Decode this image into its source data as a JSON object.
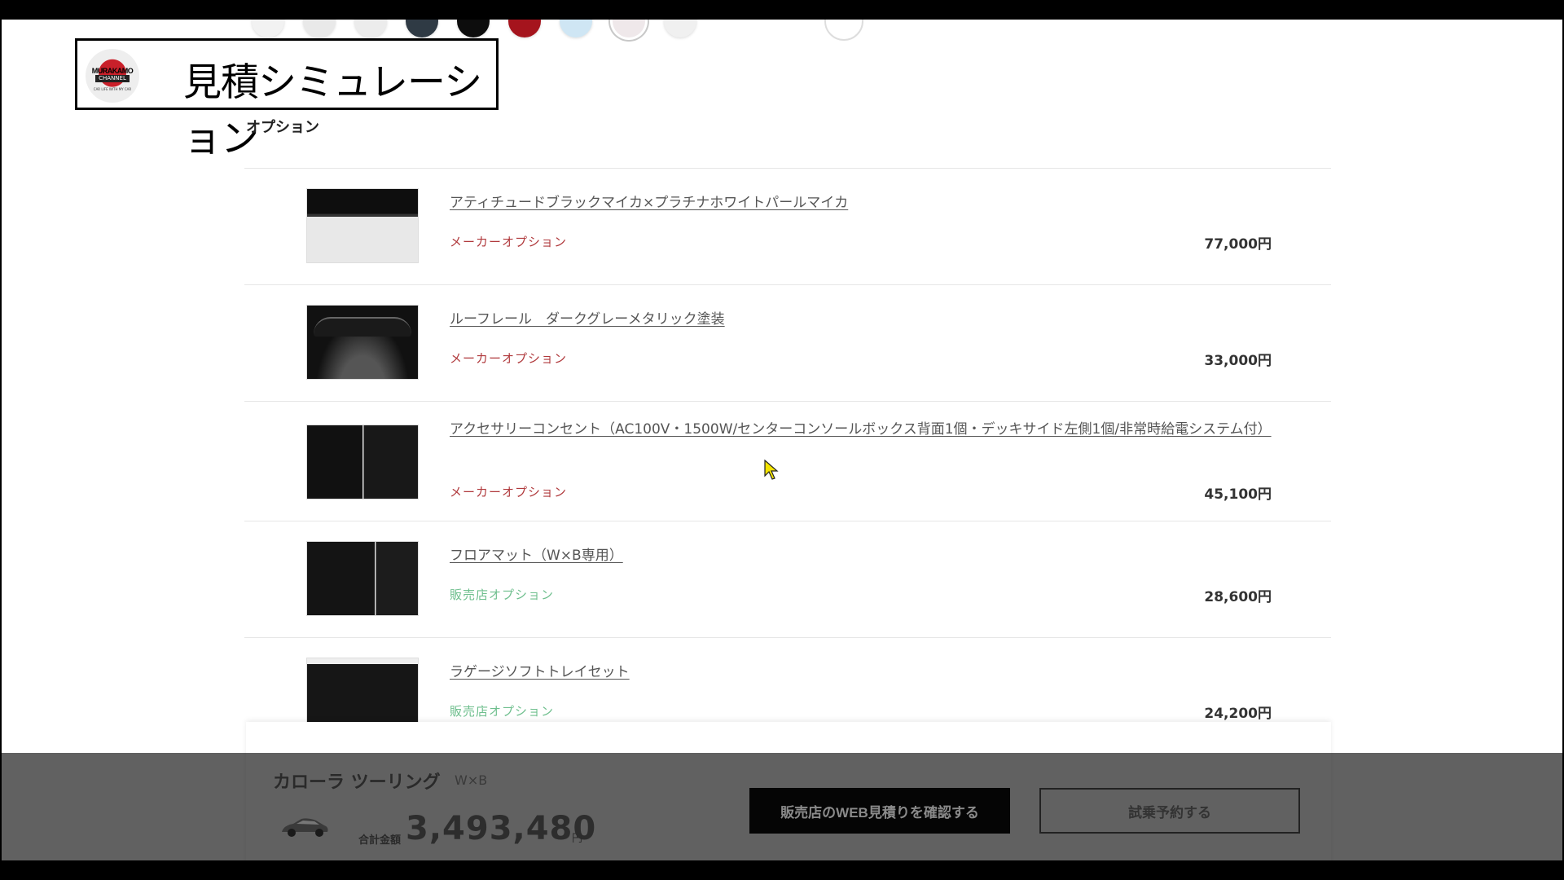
{
  "overlay": {
    "title": "見積シミュレーション",
    "logo": {
      "line1": "MURAKAMO",
      "line2": "CHANNEL",
      "sub": "CAR LIFE WITH MY CAR"
    }
  },
  "colors": {
    "swatches": [
      "#f2f2f2",
      "#e9e9e9",
      "#ececec",
      "#2f3a44",
      "#0d0d0d",
      "#a5141d",
      "#cfe6f4",
      "#efe8ea",
      "#f0f0f0"
    ],
    "selected_swatch_index": 7,
    "maker_option": "#b0393c",
    "dealer_option": "#6fbf8e"
  },
  "options_section": {
    "title": "オプション",
    "items": [
      {
        "name": "アティチュードブラックマイカ×プラチナホワイトパールマイカ",
        "type": "メーカーオプション",
        "type_kind": "maker",
        "price": "77,000円"
      },
      {
        "name": "ルーフレール　ダークグレーメタリック塗装",
        "type": "メーカーオプション",
        "type_kind": "maker",
        "price": "33,000円"
      },
      {
        "name": "アクセサリーコンセント（AC100V・1500W/センターコンソールボックス背面1個・デッキサイド左側1個/非常時給電システム付）",
        "type": "メーカーオプション",
        "type_kind": "maker",
        "price": "45,100円"
      },
      {
        "name": "フロアマット（W×B専用）",
        "type": "販売店オプション",
        "type_kind": "dealer",
        "price": "28,600円"
      },
      {
        "name": "ラゲージソフトトレイセット",
        "type": "販売店オプション",
        "type_kind": "dealer",
        "price": "24,200円"
      }
    ]
  },
  "summary": {
    "car_name": "カローラ ツーリング",
    "grade": "W×B",
    "total_label": "合計金額",
    "total_value": "3,493,480",
    "total_unit": "円",
    "web_button": "販売店のWEB見積りを確認する",
    "test_drive_button": "試乗予約する"
  }
}
